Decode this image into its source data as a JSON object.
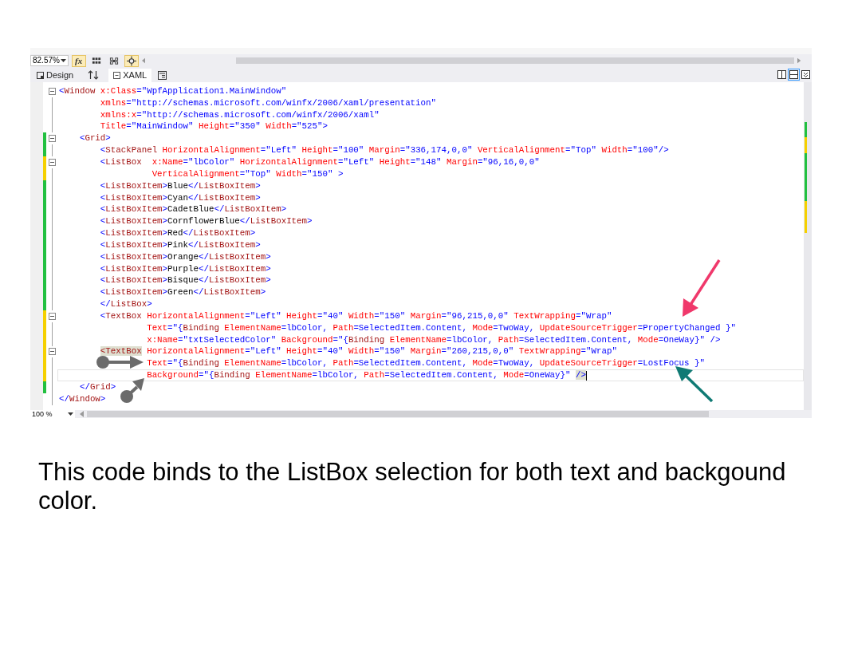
{
  "toolbar": {
    "zoom": "82.57%",
    "buttons": [
      {
        "kind": "formula",
        "label": "fx",
        "on": true
      },
      {
        "kind": "grid",
        "on": false
      },
      {
        "kind": "snap-grid",
        "on": false
      },
      {
        "kind": "crosshair",
        "on": true
      }
    ]
  },
  "tabs": [
    {
      "label": "Design",
      "selected": false
    },
    {
      "label": "XAML",
      "selected": true
    }
  ],
  "pane_buttons": [
    {
      "kind": "split-vertical",
      "selected": false
    },
    {
      "kind": "split-horizontal",
      "selected": true
    },
    {
      "kind": "collapse",
      "selected": false
    }
  ],
  "code": {
    "lines": [
      {
        "fold": true,
        "changed": false,
        "current": false,
        "tokens": [
          {
            "kind": "v",
            "text": "<"
          },
          {
            "kind": "e",
            "text": "Window"
          },
          {
            "kind": "a",
            "text": " x:Class"
          },
          {
            "kind": "v",
            "text": "=\"WpfApplication1.MainWindow\""
          }
        ]
      },
      {
        "fold": false,
        "changed": false,
        "current": false,
        "tokens": [
          {
            "kind": "a",
            "text": "        xmlns"
          },
          {
            "kind": "v",
            "text": "=\"http://schemas.microsoft.com/winfx/2006/xaml/presentation\""
          }
        ]
      },
      {
        "fold": false,
        "changed": false,
        "current": false,
        "tokens": [
          {
            "kind": "a",
            "text": "        xmlns:x"
          },
          {
            "kind": "v",
            "text": "=\"http://schemas.microsoft.com/winfx/2006/xaml\""
          }
        ]
      },
      {
        "fold": false,
        "changed": false,
        "current": false,
        "tokens": [
          {
            "kind": "a",
            "text": "        Title"
          },
          {
            "kind": "v",
            "text": "=\"MainWindow\""
          },
          {
            "kind": "a",
            "text": " Height"
          },
          {
            "kind": "v",
            "text": "=\"350\""
          },
          {
            "kind": "a",
            "text": " Width"
          },
          {
            "kind": "v",
            "text": "=\"525\">"
          }
        ]
      },
      {
        "fold": true,
        "changed": true,
        "saved": true,
        "current": false,
        "tokens": [
          {
            "kind": "v",
            "text": "    <"
          },
          {
            "kind": "e",
            "text": "Grid"
          },
          {
            "kind": "v",
            "text": ">"
          }
        ]
      },
      {
        "fold": false,
        "changed": true,
        "saved": true,
        "current": false,
        "tokens": [
          {
            "kind": "v",
            "text": "        <"
          },
          {
            "kind": "e",
            "text": "StackPanel"
          },
          {
            "kind": "a",
            "text": " HorizontalAlignment"
          },
          {
            "kind": "v",
            "text": "=\"Left\""
          },
          {
            "kind": "a",
            "text": " Height"
          },
          {
            "kind": "v",
            "text": "=\"100\""
          },
          {
            "kind": "a",
            "text": " Margin"
          },
          {
            "kind": "v",
            "text": "=\"336,174,0,0\""
          },
          {
            "kind": "a",
            "text": " VerticalAlignment"
          },
          {
            "kind": "v",
            "text": "=\"Top\""
          },
          {
            "kind": "a",
            "text": " Width"
          },
          {
            "kind": "v",
            "text": "=\"100\"/>"
          }
        ]
      },
      {
        "fold": true,
        "changed": true,
        "saved": false,
        "current": false,
        "tokens": [
          {
            "kind": "v",
            "text": "        <"
          },
          {
            "kind": "e",
            "text": "ListBox"
          },
          {
            "kind": "a",
            "text": "  x:Name"
          },
          {
            "kind": "v",
            "text": "=\"lbColor\""
          },
          {
            "kind": "a",
            "text": " HorizontalAlignment"
          },
          {
            "kind": "v",
            "text": "=\"Left\""
          },
          {
            "kind": "a",
            "text": " Height"
          },
          {
            "kind": "v",
            "text": "=\"148\""
          },
          {
            "kind": "a",
            "text": " Margin"
          },
          {
            "kind": "v",
            "text": "=\"96,16,0,0\""
          }
        ]
      },
      {
        "fold": false,
        "changed": true,
        "saved": false,
        "current": false,
        "tokens": [
          {
            "kind": "a",
            "text": "                  VerticalAlignment"
          },
          {
            "kind": "v",
            "text": "=\"Top\""
          },
          {
            "kind": "a",
            "text": " Width"
          },
          {
            "kind": "v",
            "text": "=\"150\" >"
          }
        ]
      },
      {
        "fold": false,
        "changed": true,
        "saved": true,
        "current": false,
        "tokens": [
          {
            "kind": "v",
            "text": "        <"
          },
          {
            "kind": "e",
            "text": "ListBoxItem"
          },
          {
            "kind": "v",
            "text": ">"
          },
          {
            "kind": "t",
            "text": "Blue"
          },
          {
            "kind": "v",
            "text": "</"
          },
          {
            "kind": "e",
            "text": "ListBoxItem"
          },
          {
            "kind": "v",
            "text": ">"
          }
        ]
      },
      {
        "fold": false,
        "changed": true,
        "saved": true,
        "current": false,
        "tokens": [
          {
            "kind": "v",
            "text": "        <"
          },
          {
            "kind": "e",
            "text": "ListBoxItem"
          },
          {
            "kind": "v",
            "text": ">"
          },
          {
            "kind": "t",
            "text": "Cyan"
          },
          {
            "kind": "v",
            "text": "</"
          },
          {
            "kind": "e",
            "text": "ListBoxItem"
          },
          {
            "kind": "v",
            "text": ">"
          }
        ]
      },
      {
        "fold": false,
        "changed": true,
        "saved": true,
        "current": false,
        "tokens": [
          {
            "kind": "v",
            "text": "        <"
          },
          {
            "kind": "e",
            "text": "ListBoxItem"
          },
          {
            "kind": "v",
            "text": ">"
          },
          {
            "kind": "t",
            "text": "CadetBlue"
          },
          {
            "kind": "v",
            "text": "</"
          },
          {
            "kind": "e",
            "text": "ListBoxItem"
          },
          {
            "kind": "v",
            "text": ">"
          }
        ]
      },
      {
        "fold": false,
        "changed": true,
        "saved": true,
        "current": false,
        "tokens": [
          {
            "kind": "v",
            "text": "        <"
          },
          {
            "kind": "e",
            "text": "ListBoxItem"
          },
          {
            "kind": "v",
            "text": ">"
          },
          {
            "kind": "t",
            "text": "CornflowerBlue"
          },
          {
            "kind": "v",
            "text": "</"
          },
          {
            "kind": "e",
            "text": "ListBoxItem"
          },
          {
            "kind": "v",
            "text": ">"
          }
        ]
      },
      {
        "fold": false,
        "changed": true,
        "saved": true,
        "current": false,
        "tokens": [
          {
            "kind": "v",
            "text": "        <"
          },
          {
            "kind": "e",
            "text": "ListBoxItem"
          },
          {
            "kind": "v",
            "text": ">"
          },
          {
            "kind": "t",
            "text": "Red"
          },
          {
            "kind": "v",
            "text": "</"
          },
          {
            "kind": "e",
            "text": "ListBoxItem"
          },
          {
            "kind": "v",
            "text": ">"
          }
        ]
      },
      {
        "fold": false,
        "changed": true,
        "saved": true,
        "current": false,
        "tokens": [
          {
            "kind": "v",
            "text": "        <"
          },
          {
            "kind": "e",
            "text": "ListBoxItem"
          },
          {
            "kind": "v",
            "text": ">"
          },
          {
            "kind": "t",
            "text": "Pink"
          },
          {
            "kind": "v",
            "text": "</"
          },
          {
            "kind": "e",
            "text": "ListBoxItem"
          },
          {
            "kind": "v",
            "text": ">"
          }
        ]
      },
      {
        "fold": false,
        "changed": true,
        "saved": true,
        "current": false,
        "tokens": [
          {
            "kind": "v",
            "text": "        <"
          },
          {
            "kind": "e",
            "text": "ListBoxItem"
          },
          {
            "kind": "v",
            "text": ">"
          },
          {
            "kind": "t",
            "text": "Orange"
          },
          {
            "kind": "v",
            "text": "</"
          },
          {
            "kind": "e",
            "text": "ListBoxItem"
          },
          {
            "kind": "v",
            "text": ">"
          }
        ]
      },
      {
        "fold": false,
        "changed": true,
        "saved": true,
        "current": false,
        "tokens": [
          {
            "kind": "v",
            "text": "        <"
          },
          {
            "kind": "e",
            "text": "ListBoxItem"
          },
          {
            "kind": "v",
            "text": ">"
          },
          {
            "kind": "t",
            "text": "Purple"
          },
          {
            "kind": "v",
            "text": "</"
          },
          {
            "kind": "e",
            "text": "ListBoxItem"
          },
          {
            "kind": "v",
            "text": ">"
          }
        ]
      },
      {
        "fold": false,
        "changed": true,
        "saved": true,
        "current": false,
        "tokens": [
          {
            "kind": "v",
            "text": "        <"
          },
          {
            "kind": "e",
            "text": "ListBoxItem"
          },
          {
            "kind": "v",
            "text": ">"
          },
          {
            "kind": "t",
            "text": "Bisque"
          },
          {
            "kind": "v",
            "text": "</"
          },
          {
            "kind": "e",
            "text": "ListBoxItem"
          },
          {
            "kind": "v",
            "text": ">"
          }
        ]
      },
      {
        "fold": false,
        "changed": true,
        "saved": true,
        "current": false,
        "tokens": [
          {
            "kind": "v",
            "text": "        <"
          },
          {
            "kind": "e",
            "text": "ListBoxItem"
          },
          {
            "kind": "v",
            "text": ">"
          },
          {
            "kind": "t",
            "text": "Green"
          },
          {
            "kind": "v",
            "text": "</"
          },
          {
            "kind": "e",
            "text": "ListBoxItem"
          },
          {
            "kind": "v",
            "text": ">"
          }
        ]
      },
      {
        "fold": false,
        "changed": true,
        "saved": true,
        "current": false,
        "tokens": [
          {
            "kind": "v",
            "text": "        </"
          },
          {
            "kind": "e",
            "text": "ListBox"
          },
          {
            "kind": "v",
            "text": ">"
          }
        ]
      },
      {
        "fold": true,
        "changed": true,
        "saved": false,
        "current": false,
        "tokens": [
          {
            "kind": "v",
            "text": "        <"
          },
          {
            "kind": "e",
            "text": "TextBox"
          },
          {
            "kind": "a",
            "text": " HorizontalAlignment"
          },
          {
            "kind": "v",
            "text": "=\"Left\""
          },
          {
            "kind": "a",
            "text": " Height"
          },
          {
            "kind": "v",
            "text": "=\"40\""
          },
          {
            "kind": "a",
            "text": " Width"
          },
          {
            "kind": "v",
            "text": "=\"150\""
          },
          {
            "kind": "a",
            "text": " Margin"
          },
          {
            "kind": "v",
            "text": "=\"96,215,0,0\""
          },
          {
            "kind": "a",
            "text": " TextWrapping"
          },
          {
            "kind": "v",
            "text": "=\"Wrap\""
          }
        ]
      },
      {
        "fold": false,
        "changed": true,
        "saved": false,
        "current": false,
        "tokens": [
          {
            "kind": "a",
            "text": "                 Text"
          },
          {
            "kind": "v",
            "text": "=\"{"
          },
          {
            "kind": "e",
            "text": "Binding"
          },
          {
            "kind": "a",
            "text": " ElementName"
          },
          {
            "kind": "v",
            "text": "=lbColor,"
          },
          {
            "kind": "a",
            "text": " Path"
          },
          {
            "kind": "v",
            "text": "=SelectedItem.Content,"
          },
          {
            "kind": "a",
            "text": " Mode"
          },
          {
            "kind": "v",
            "text": "=TwoWay,"
          },
          {
            "kind": "a",
            "text": " UpdateSourceTrigger"
          },
          {
            "kind": "v",
            "text": "=PropertyChanged }\""
          }
        ]
      },
      {
        "fold": false,
        "changed": true,
        "saved": false,
        "current": false,
        "tokens": [
          {
            "kind": "a",
            "text": "                 x:Name"
          },
          {
            "kind": "v",
            "text": "=\"txtSelectedColor\""
          },
          {
            "kind": "a",
            "text": " Background"
          },
          {
            "kind": "v",
            "text": "=\"{"
          },
          {
            "kind": "e",
            "text": "Binding"
          },
          {
            "kind": "a",
            "text": " ElementName"
          },
          {
            "kind": "v",
            "text": "=lbColor,"
          },
          {
            "kind": "a",
            "text": " Path"
          },
          {
            "kind": "v",
            "text": "=SelectedItem.Content,"
          },
          {
            "kind": "a",
            "text": " Mode"
          },
          {
            "kind": "v",
            "text": "=OneWay}\" />"
          }
        ]
      },
      {
        "fold": true,
        "changed": true,
        "saved": false,
        "current": false,
        "tokens": [
          {
            "kind": "e",
            "text": "        <TextBox",
            "highlight": true
          },
          {
            "kind": "a",
            "text": " HorizontalAlignment"
          },
          {
            "kind": "v",
            "text": "=\"Left\""
          },
          {
            "kind": "a",
            "text": " Height"
          },
          {
            "kind": "v",
            "text": "=\"40\""
          },
          {
            "kind": "a",
            "text": " Width"
          },
          {
            "kind": "v",
            "text": "=\"150\""
          },
          {
            "kind": "a",
            "text": " Margin"
          },
          {
            "kind": "v",
            "text": "=\"260,215,0,0\""
          },
          {
            "kind": "a",
            "text": " TextWrapping"
          },
          {
            "kind": "v",
            "text": "=\"Wrap\""
          }
        ]
      },
      {
        "fold": false,
        "changed": true,
        "saved": false,
        "current": false,
        "tokens": [
          {
            "kind": "a",
            "text": "                 Text"
          },
          {
            "kind": "v",
            "text": "=\"{"
          },
          {
            "kind": "e",
            "text": "Binding"
          },
          {
            "kind": "a",
            "text": " ElementName"
          },
          {
            "kind": "v",
            "text": "=lbColor,"
          },
          {
            "kind": "a",
            "text": " Path"
          },
          {
            "kind": "v",
            "text": "=SelectedItem.Content,"
          },
          {
            "kind": "a",
            "text": " Mode"
          },
          {
            "kind": "v",
            "text": "=TwoWay,"
          },
          {
            "kind": "a",
            "text": " UpdateSourceTrigger"
          },
          {
            "kind": "v",
            "text": "=LostFocus }\""
          }
        ]
      },
      {
        "fold": false,
        "changed": true,
        "saved": false,
        "current": true,
        "tokens": [
          {
            "kind": "a",
            "text": "                 Background"
          },
          {
            "kind": "v",
            "text": "=\"{"
          },
          {
            "kind": "e",
            "text": "Binding"
          },
          {
            "kind": "a",
            "text": " ElementName"
          },
          {
            "kind": "v",
            "text": "=lbColor,"
          },
          {
            "kind": "a",
            "text": " Path"
          },
          {
            "kind": "v",
            "text": "=SelectedItem.Content,"
          },
          {
            "kind": "a",
            "text": " Mode"
          },
          {
            "kind": "v",
            "text": "=OneWay}\" "
          },
          {
            "kind": "v",
            "text": "/>",
            "highlight": true
          }
        ]
      },
      {
        "fold": false,
        "changed": true,
        "saved": true,
        "current": false,
        "tokens": [
          {
            "kind": "v",
            "text": "    </"
          },
          {
            "kind": "e",
            "text": "Grid"
          },
          {
            "kind": "v",
            "text": ">"
          }
        ]
      },
      {
        "fold": false,
        "changed": false,
        "current": false,
        "tokens": [
          {
            "kind": "v",
            "text": "</"
          },
          {
            "kind": "e",
            "text": "Window"
          },
          {
            "kind": "v",
            "text": ">"
          }
        ]
      }
    ]
  },
  "bottom_zoom": "100 %",
  "caption": "This code binds to the ListBox selection for both text and backgound color."
}
